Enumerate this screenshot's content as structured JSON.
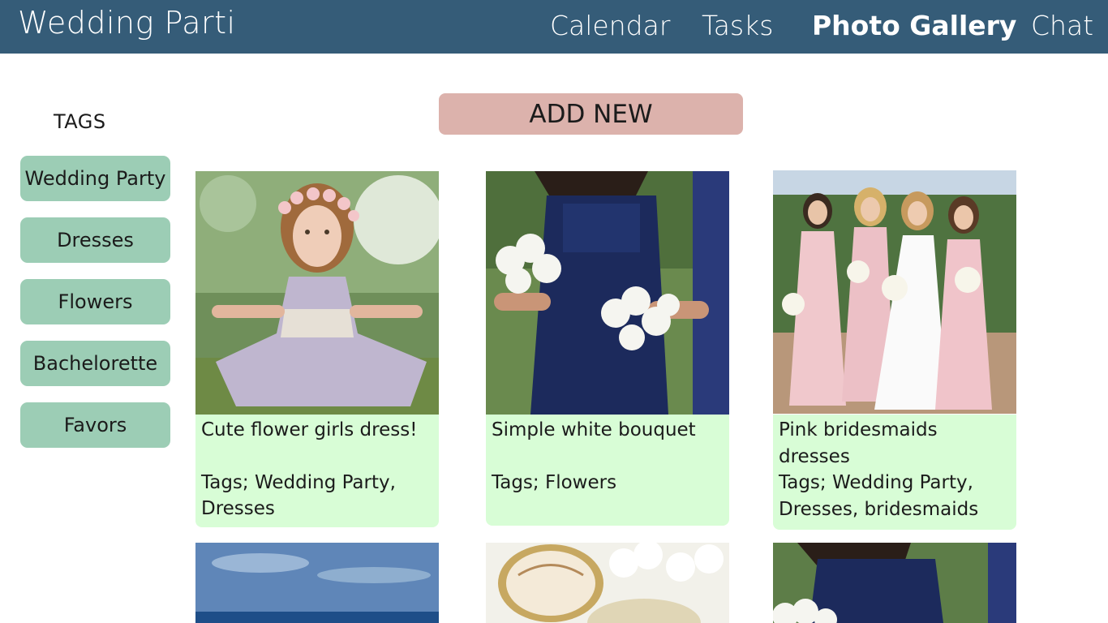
{
  "app": {
    "title": "Wedding Parti"
  },
  "nav": {
    "calendar": "Calendar",
    "tasks": "Tasks",
    "gallery": "Photo Gallery",
    "chat": "Chat"
  },
  "sidebar": {
    "heading": "TAGS",
    "tags": [
      "Wedding Party",
      "Dresses",
      "Flowers",
      "Bachelorette",
      "Favors"
    ]
  },
  "actions": {
    "add_new": "ADD NEW"
  },
  "gallery": {
    "cards": [
      {
        "title": "Cute flower girls dress!",
        "tags": "Tags; Wedding Party, Dresses"
      },
      {
        "title": "Simple white bouquet",
        "tags": "Tags; Flowers"
      },
      {
        "title": "Pink bridesmaids dresses",
        "tags": "Tags; Wedding Party, Dresses, bridesmaids"
      }
    ]
  },
  "colors": {
    "header": "#355c78",
    "tag_button": "#9ccdb5",
    "add_button": "#dcb2ac",
    "caption_bg": "#d8fdd6"
  }
}
